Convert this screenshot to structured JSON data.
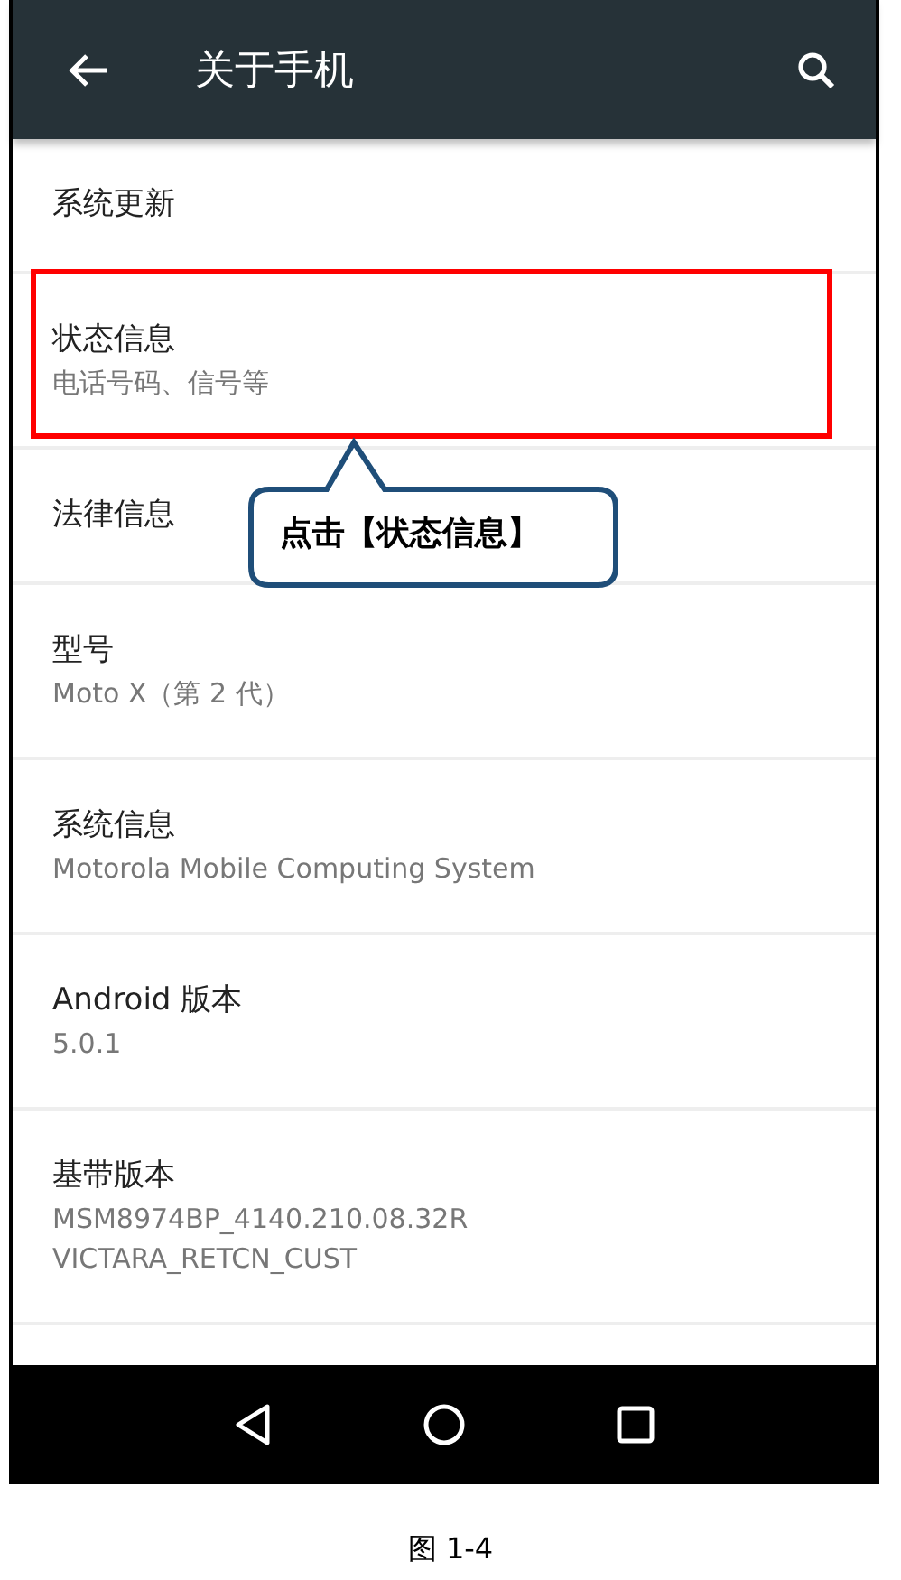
{
  "app_bar": {
    "title": "关于手机"
  },
  "items": [
    {
      "title": "系统更新",
      "highlighted": false
    },
    {
      "title": "状态信息",
      "summary": [
        "电话号码、信号等"
      ],
      "highlighted": true
    },
    {
      "title": "法律信息",
      "highlighted": false
    },
    {
      "title": "型号",
      "summary": [
        "Moto X（第 2 代）"
      ],
      "highlighted": false
    },
    {
      "title": "系统信息",
      "summary": [
        "Motorola Mobile Computing System"
      ],
      "highlighted": false
    },
    {
      "title": "Android 版本",
      "summary": [
        "5.0.1"
      ],
      "highlighted": false
    },
    {
      "title": "基带版本",
      "summary": [
        "MSM8974BP_4140.210.08.32R",
        "VICTARA_RETCN_CUST"
      ],
      "highlighted": false
    }
  ],
  "callout": {
    "text": "点击【状态信息】"
  },
  "caption": "图 1-4"
}
